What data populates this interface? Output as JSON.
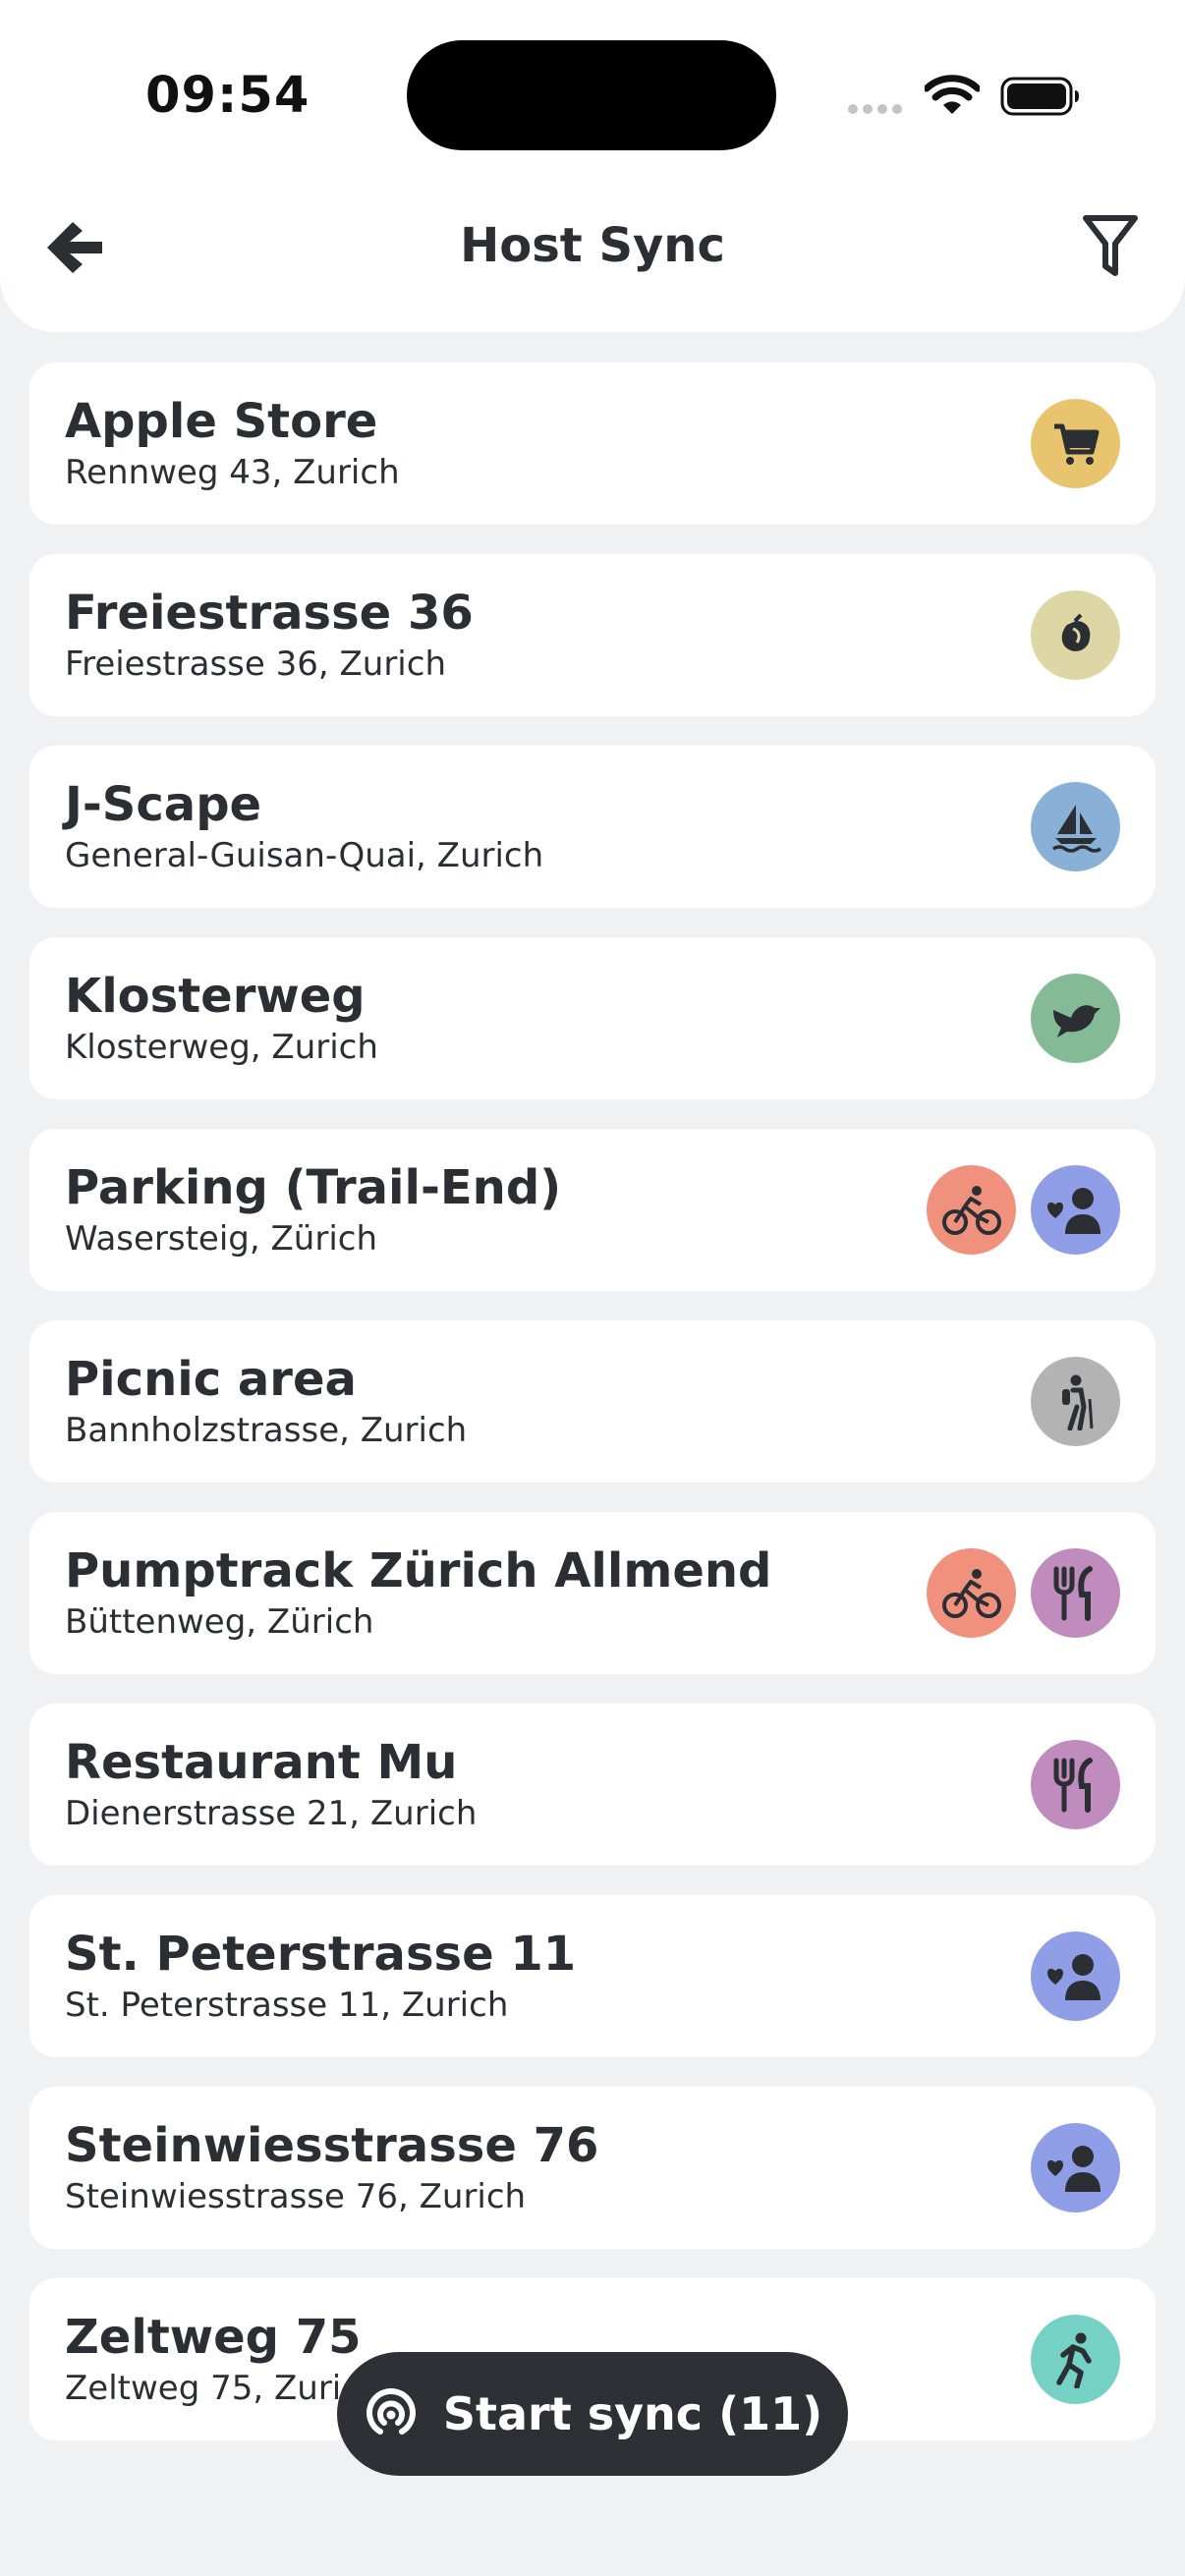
{
  "status_bar": {
    "time": "09:54"
  },
  "header": {
    "title": "Host Sync"
  },
  "colors": {
    "shop": "#e8c46f",
    "garden": "#dcd7a5",
    "boat": "#89b0d6",
    "bird": "#84bb96",
    "bike": "#f0917e",
    "host": "#8f9ee6",
    "hike": "#b3b3b3",
    "food": "#c08bbd",
    "run": "#74d1c4"
  },
  "locations": [
    {
      "name": "Apple Store",
      "address": "Rennweg 43, Zurich",
      "icons": [
        "cart-icon"
      ]
    },
    {
      "name": "Freiestrasse 36",
      "address": "Freiestrasse 36, Zurich",
      "icons": [
        "seed-icon"
      ]
    },
    {
      "name": "J-Scape",
      "address": "General-Guisan-Quai, Zurich",
      "icons": [
        "sailboat-icon"
      ]
    },
    {
      "name": "Klosterweg",
      "address": "Klosterweg, Zurich",
      "icons": [
        "bird-icon"
      ]
    },
    {
      "name": "Parking (Trail-End)",
      "address": "Wasersteig, Zürich",
      "icons": [
        "bicycle-icon",
        "host-heart-icon"
      ]
    },
    {
      "name": "Picnic area",
      "address": "Bannholzstrasse, Zurich",
      "icons": [
        "hiker-icon"
      ]
    },
    {
      "name": "Pumptrack Zürich Allmend",
      "address": "Büttenweg, Zürich",
      "icons": [
        "bicycle-icon",
        "fork-knife-icon"
      ]
    },
    {
      "name": "Restaurant Mu",
      "address": "Dienerstrasse 21, Zurich",
      "icons": [
        "fork-knife-icon"
      ]
    },
    {
      "name": "St. Peterstrasse 11",
      "address": "St. Peterstrasse 11, Zurich",
      "icons": [
        "host-heart-icon"
      ]
    },
    {
      "name": "Steinwiesstrasse 76",
      "address": "Steinwiesstrasse 76, Zurich",
      "icons": [
        "host-heart-icon"
      ]
    },
    {
      "name": "Zeltweg 75",
      "address": "Zeltweg 75, Zurich",
      "icons": [
        "runner-icon"
      ]
    }
  ],
  "actions": {
    "start_sync_label": "Start sync (11)"
  }
}
